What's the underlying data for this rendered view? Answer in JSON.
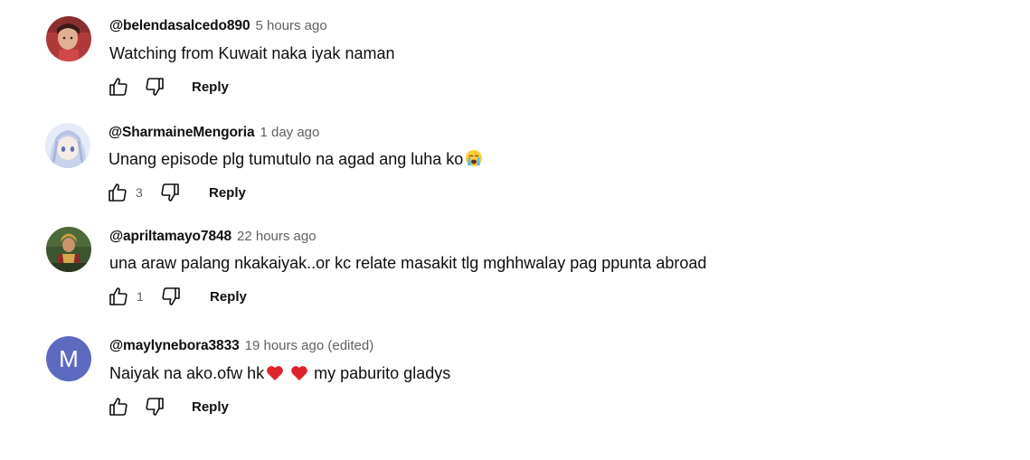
{
  "comments": [
    {
      "author": "@belendasalcedo890",
      "time": "5 hours ago",
      "text": "Watching from Kuwait naka iyak naman",
      "likes": "",
      "reply_label": "Reply",
      "avatar": {
        "type": "photo",
        "colors": [
          "#c64a4a",
          "#e8b89a",
          "#7a2a2a"
        ]
      }
    },
    {
      "author": "@SharmaineMengoria",
      "time": "1 day ago",
      "text": "Unang episode plg tumutulo na agad ang luha ko",
      "emoji": "loudly-crying-face-emoji",
      "likes": "3",
      "reply_label": "Reply",
      "avatar": {
        "type": "anime",
        "colors": [
          "#dfe6f5",
          "#8fa6d6",
          "#4a5a8a"
        ]
      }
    },
    {
      "author": "@apriltamayo7848",
      "time": "22 hours ago",
      "text": "una araw palang nkakaiyak..or kc relate masakit tlg mghhwalay pag ppunta abroad",
      "likes": "1",
      "reply_label": "Reply",
      "avatar": {
        "type": "photo",
        "colors": [
          "#3e5a2e",
          "#c8a040",
          "#8a2a2a"
        ]
      }
    },
    {
      "author": "@maylynebora3833",
      "time": "19 hours ago (edited)",
      "text_before": "Naiyak na ako.ofw hk",
      "text_after": "my paburito gladys",
      "emoji": "red-heart-emoji",
      "likes": "",
      "reply_label": "Reply",
      "avatar": {
        "type": "letter",
        "letter": "M",
        "color": "#5c6bc0"
      }
    }
  ]
}
